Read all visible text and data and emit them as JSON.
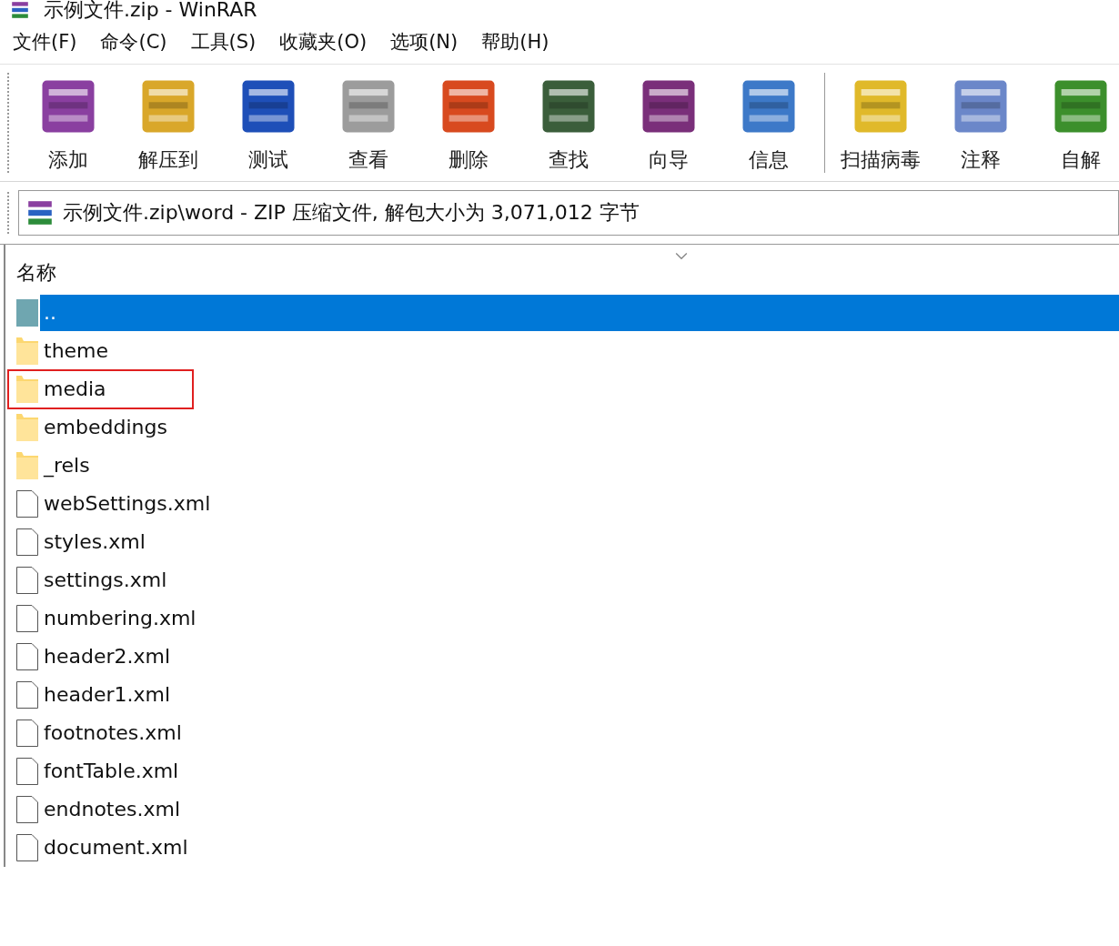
{
  "window": {
    "title": "示例文件.zip - WinRAR"
  },
  "menu": [
    "文件(F)",
    "命令(C)",
    "工具(S)",
    "收藏夹(O)",
    "选项(N)",
    "帮助(H)"
  ],
  "toolbar": [
    {
      "label": "添加",
      "separator_before": false
    },
    {
      "label": "解压到",
      "separator_before": false
    },
    {
      "label": "测试",
      "separator_before": false
    },
    {
      "label": "查看",
      "separator_before": false
    },
    {
      "label": "删除",
      "separator_before": false
    },
    {
      "label": "查找",
      "separator_before": false
    },
    {
      "label": "向导",
      "separator_before": false
    },
    {
      "label": "信息",
      "separator_before": false
    },
    {
      "label": "扫描病毒",
      "separator_before": true
    },
    {
      "label": "注释",
      "separator_before": false
    },
    {
      "label": "自解",
      "separator_before": false
    }
  ],
  "address": {
    "value": "示例文件.zip\\word - ZIP 压缩文件, 解包大小为 3,071,012 字节"
  },
  "table": {
    "columns": [
      "名称"
    ],
    "rows": [
      {
        "name": "..",
        "kind": "parent",
        "selected": true,
        "highlighted": false
      },
      {
        "name": "theme",
        "kind": "folder",
        "selected": false,
        "highlighted": false
      },
      {
        "name": "media",
        "kind": "folder",
        "selected": false,
        "highlighted": true
      },
      {
        "name": "embeddings",
        "kind": "folder",
        "selected": false,
        "highlighted": false
      },
      {
        "name": "_rels",
        "kind": "folder",
        "selected": false,
        "highlighted": false
      },
      {
        "name": "webSettings.xml",
        "kind": "file",
        "selected": false,
        "highlighted": false
      },
      {
        "name": "styles.xml",
        "kind": "file",
        "selected": false,
        "highlighted": false
      },
      {
        "name": "settings.xml",
        "kind": "file",
        "selected": false,
        "highlighted": false
      },
      {
        "name": "numbering.xml",
        "kind": "file",
        "selected": false,
        "highlighted": false
      },
      {
        "name": "header2.xml",
        "kind": "file",
        "selected": false,
        "highlighted": false
      },
      {
        "name": "header1.xml",
        "kind": "file",
        "selected": false,
        "highlighted": false
      },
      {
        "name": "footnotes.xml",
        "kind": "file",
        "selected": false,
        "highlighted": false
      },
      {
        "name": "fontTable.xml",
        "kind": "file",
        "selected": false,
        "highlighted": false
      },
      {
        "name": "endnotes.xml",
        "kind": "file",
        "selected": false,
        "highlighted": false
      },
      {
        "name": "document.xml",
        "kind": "file",
        "selected": false,
        "highlighted": false
      }
    ]
  }
}
